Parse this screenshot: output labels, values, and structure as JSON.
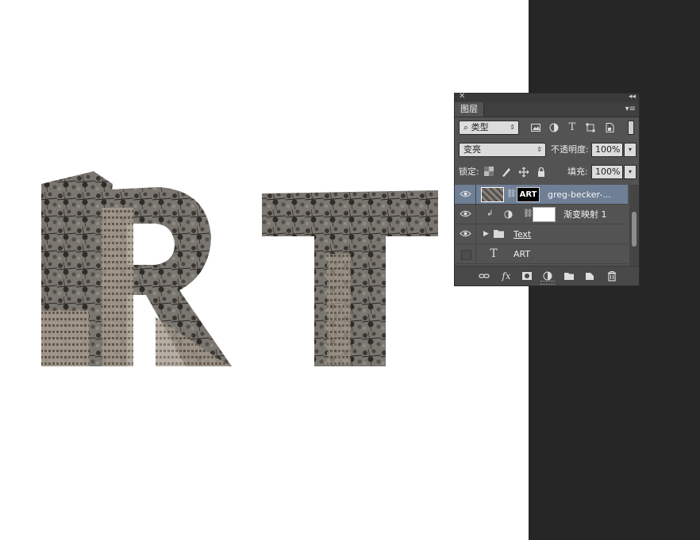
{
  "canvas": {
    "background": "#ffffff",
    "workspace_background": "#262626",
    "artwork_text": "ART"
  },
  "panel": {
    "close_glyph": "✕",
    "collapse_glyph": "◂◂",
    "tab_label": "图层",
    "menu_glyph": "▾≡",
    "filter": {
      "kind_label": "⌕ 类型",
      "icons": [
        "image-filter-icon",
        "adjustment-filter-icon",
        "type-filter-icon",
        "shape-filter-icon",
        "smart-object-filter-icon"
      ]
    },
    "blend": {
      "mode": "变亮",
      "opacity_label": "不透明度:",
      "opacity_value": "100%"
    },
    "lock": {
      "label": "锁定:",
      "fill_label": "填充:",
      "fill_value": "100%"
    },
    "layers": [
      {
        "name": "greg-becker-...",
        "visible": true,
        "selected": true,
        "mask_text": "ART"
      },
      {
        "name": "渐变映射 1",
        "visible": true,
        "selected": false
      },
      {
        "name": "Text",
        "visible": true,
        "selected": false
      },
      {
        "name": "ART",
        "visible": false,
        "selected": false
      }
    ],
    "colors": {
      "panel_bg": "#535353",
      "selected_row": "#6e7f96"
    }
  }
}
